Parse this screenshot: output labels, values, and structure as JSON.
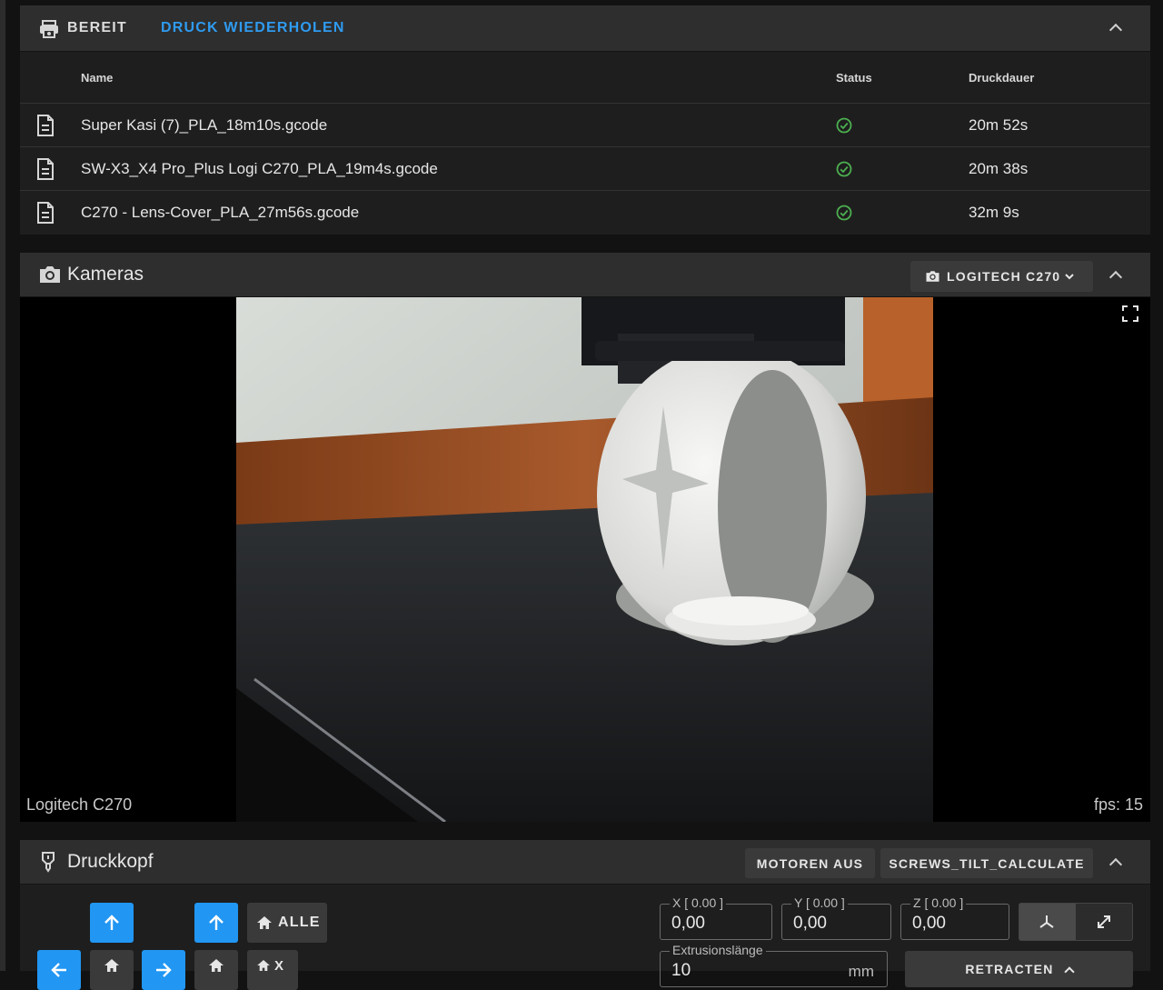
{
  "jobs": {
    "status": "Bereit",
    "reprint": "Druck wiederholen",
    "columns": {
      "name": "Name",
      "status": "Status",
      "duration": "Druckdauer"
    },
    "rows": [
      {
        "name": "Super Kasi (7)_PLA_18m10s.gcode",
        "status": "success",
        "duration": "20m 52s"
      },
      {
        "name": "SW-X3_X4 Pro_Plus Logi C270_PLA_19m4s.gcode",
        "status": "success",
        "duration": "20m 38s"
      },
      {
        "name": "C270 - Lens-Cover_PLA_27m56s.gcode",
        "status": "success",
        "duration": "32m 9s"
      }
    ]
  },
  "camera": {
    "title": "Kameras",
    "selected": "Logitech C270",
    "caption": "Logitech C270",
    "fps": "fps: 15"
  },
  "toolhead": {
    "title": "Druckkopf",
    "motors_off": "Motoren aus",
    "macro": "SCREWS_TILT_CALCULATE",
    "home_all": "Alle",
    "home_x_partial": "X",
    "x_label": "X [ 0.00 ]",
    "y_label": "Y [ 0.00 ]",
    "z_label": "Z [ 0.00 ]",
    "x_value": "0,00",
    "y_value": "0,00",
    "z_value": "0,00",
    "extrusion_label": "Extrusionslänge",
    "extrusion_value": "10",
    "extrusion_unit": "mm",
    "retract": "Retracten"
  },
  "colors": {
    "accent": "#2196f3",
    "success": "#4caf50"
  }
}
